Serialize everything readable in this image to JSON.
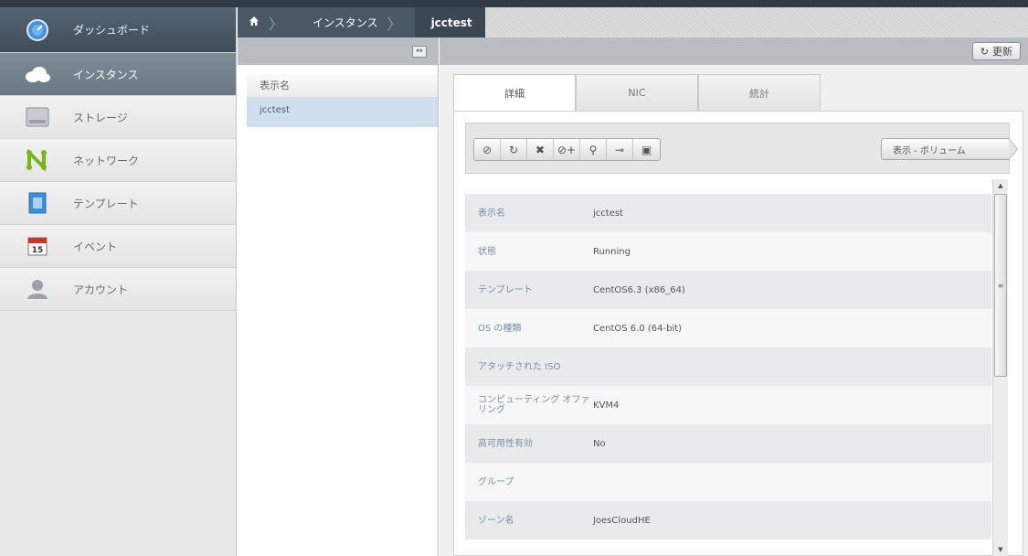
{
  "nav": {
    "items": [
      {
        "label": "ダッシュボード",
        "icon": "dashboard-icon"
      },
      {
        "label": "インスタンス",
        "icon": "cloud-icon"
      },
      {
        "label": "ストレージ",
        "icon": "disk-icon"
      },
      {
        "label": "ネットワーク",
        "icon": "network-icon"
      },
      {
        "label": "テンプレート",
        "icon": "template-icon"
      },
      {
        "label": "イベント",
        "icon": "calendar-icon",
        "badge": "15"
      },
      {
        "label": "アカウント",
        "icon": "user-icon"
      }
    ]
  },
  "breadcrumb": {
    "home_icon": "home-icon",
    "section": "インスタンス",
    "current": "jcctest"
  },
  "list": {
    "header": "表示名",
    "rows": [
      "jcctest"
    ]
  },
  "toolbar": {
    "refresh_label": "更新"
  },
  "tabs": [
    "詳細",
    "NIC",
    "統計"
  ],
  "actions": {
    "icons": [
      "stop-icon",
      "reboot-icon",
      "destroy-icon",
      "attach-iso-icon",
      "reset-password-icon",
      "migrate-icon",
      "console-icon"
    ],
    "view_button": "表示 - ボリューム"
  },
  "details": [
    {
      "key": "表示名",
      "value": "jcctest"
    },
    {
      "key": "状態",
      "value": "Running"
    },
    {
      "key": "テンプレート",
      "value": "CentOS6.3 (x86_64)"
    },
    {
      "key": "OS の種類",
      "value": "CentOS 6.0 (64-bit)"
    },
    {
      "key": "アタッチされた ISO",
      "value": ""
    },
    {
      "key": "コンピューティング オファリング",
      "value": "KVM4"
    },
    {
      "key": "高可用性有効",
      "value": "No"
    },
    {
      "key": "グループ",
      "value": ""
    },
    {
      "key": "ゾーン名",
      "value": "JoesCloudHE"
    }
  ],
  "colors": {
    "sidebar_active": "#6b7884",
    "breadcrumb": "#4a5866",
    "selected_row": "#cfdfee",
    "label_blue": "#7a8ea8"
  }
}
